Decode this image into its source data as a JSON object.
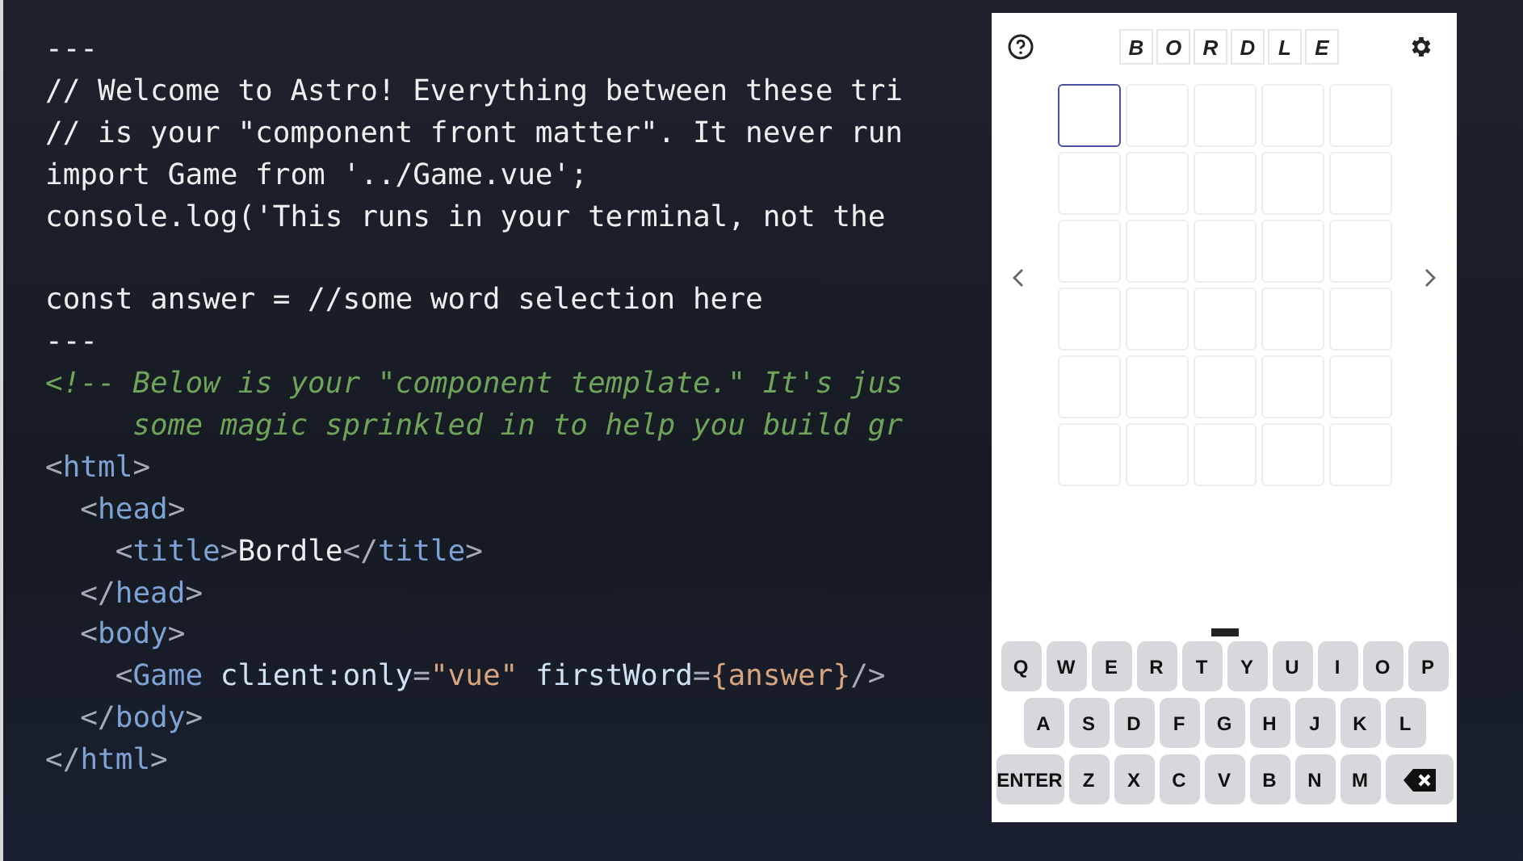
{
  "code_lines": [
    [
      {
        "kind": "plain",
        "text": "---"
      }
    ],
    [
      {
        "kind": "plain",
        "text": "// Welcome to Astro! Everything between these tri"
      }
    ],
    [
      {
        "kind": "plain",
        "text": "// is your \"component front matter\". It never run"
      }
    ],
    [
      {
        "kind": "plain",
        "text": "import Game from '../Game.vue';"
      }
    ],
    [
      {
        "kind": "plain",
        "text": "console.log('This runs in your terminal, not the"
      }
    ],
    [
      {
        "kind": "plain",
        "text": "const answer = //some word selection here",
        "gap_before": true
      }
    ],
    [
      {
        "kind": "plain",
        "text": "---"
      }
    ],
    [
      {
        "kind": "comment",
        "text": "<!-- Below is your \"component template.\" It's jus"
      }
    ],
    [
      {
        "kind": "comment",
        "text": "     some magic sprinkled in to help you build gr"
      }
    ],
    [
      {
        "kind": "punct",
        "text": "<"
      },
      {
        "kind": "tag",
        "text": "html"
      },
      {
        "kind": "punct",
        "text": ">"
      }
    ],
    [
      {
        "kind": "punct",
        "text": "  <"
      },
      {
        "kind": "tag",
        "text": "head"
      },
      {
        "kind": "punct",
        "text": ">"
      }
    ],
    [
      {
        "kind": "punct",
        "text": "    <"
      },
      {
        "kind": "tag",
        "text": "title"
      },
      {
        "kind": "punct",
        "text": ">"
      },
      {
        "kind": "plain",
        "text": "Bordle"
      },
      {
        "kind": "punct",
        "text": "</"
      },
      {
        "kind": "tag",
        "text": "title"
      },
      {
        "kind": "punct",
        "text": ">"
      }
    ],
    [
      {
        "kind": "punct",
        "text": "  </"
      },
      {
        "kind": "tag",
        "text": "head"
      },
      {
        "kind": "punct",
        "text": ">"
      }
    ],
    [
      {
        "kind": "punct",
        "text": "  <"
      },
      {
        "kind": "tag",
        "text": "body"
      },
      {
        "kind": "punct",
        "text": ">"
      }
    ],
    [
      {
        "kind": "punct",
        "text": "    <"
      },
      {
        "kind": "tag",
        "text": "Game"
      },
      {
        "kind": "attr",
        "text": "client:only",
        "space_before": true
      },
      {
        "kind": "punct",
        "text": "="
      },
      {
        "kind": "string",
        "text": "\"vue\""
      },
      {
        "kind": "attr",
        "text": "firstWord",
        "space_before": true
      },
      {
        "kind": "punct",
        "text": "="
      },
      {
        "kind": "string",
        "text": "{answer}"
      },
      {
        "kind": "punct",
        "text": "/>"
      }
    ],
    [
      {
        "kind": "punct",
        "text": "  </"
      },
      {
        "kind": "tag",
        "text": "body"
      },
      {
        "kind": "punct",
        "text": ">"
      }
    ],
    [
      {
        "kind": "punct",
        "text": "</"
      },
      {
        "kind": "tag",
        "text": "html"
      },
      {
        "kind": "punct",
        "text": ">"
      }
    ]
  ],
  "game": {
    "title_letters": [
      "B",
      "O",
      "R",
      "D",
      "L",
      "E"
    ],
    "board": [
      [
        {
          "selected": true
        },
        {
          "selected": false
        },
        {
          "selected": false
        },
        {
          "selected": false
        },
        {
          "selected": false
        }
      ],
      [
        {
          "selected": false
        },
        {
          "selected": false
        },
        {
          "selected": false
        },
        {
          "selected": false
        },
        {
          "selected": false
        }
      ],
      [
        {
          "selected": false
        },
        {
          "selected": false
        },
        {
          "selected": false
        },
        {
          "selected": false
        },
        {
          "selected": false
        }
      ],
      [
        {
          "selected": false
        },
        {
          "selected": false
        },
        {
          "selected": false
        },
        {
          "selected": false
        },
        {
          "selected": false
        }
      ],
      [
        {
          "selected": false
        },
        {
          "selected": false
        },
        {
          "selected": false
        },
        {
          "selected": false
        },
        {
          "selected": false
        }
      ],
      [
        {
          "selected": false
        },
        {
          "selected": false
        },
        {
          "selected": false
        },
        {
          "selected": false
        },
        {
          "selected": false
        }
      ]
    ],
    "keyboard": [
      [
        {
          "kind": "letter",
          "label": "Q"
        },
        {
          "kind": "letter",
          "label": "W"
        },
        {
          "kind": "letter",
          "label": "E"
        },
        {
          "kind": "letter",
          "label": "R"
        },
        {
          "kind": "letter",
          "label": "T"
        },
        {
          "kind": "letter",
          "label": "Y"
        },
        {
          "kind": "letter",
          "label": "U"
        },
        {
          "kind": "letter",
          "label": "I"
        },
        {
          "kind": "letter",
          "label": "O"
        },
        {
          "kind": "letter",
          "label": "P"
        }
      ],
      [
        {
          "kind": "letter",
          "label": "A"
        },
        {
          "kind": "letter",
          "label": "S"
        },
        {
          "kind": "letter",
          "label": "D"
        },
        {
          "kind": "letter",
          "label": "F"
        },
        {
          "kind": "letter",
          "label": "G"
        },
        {
          "kind": "letter",
          "label": "H"
        },
        {
          "kind": "letter",
          "label": "J"
        },
        {
          "kind": "letter",
          "label": "K"
        },
        {
          "kind": "letter",
          "label": "L"
        }
      ],
      [
        {
          "kind": "enter",
          "label": "ENTER"
        },
        {
          "kind": "letter",
          "label": "Z"
        },
        {
          "kind": "letter",
          "label": "X"
        },
        {
          "kind": "letter",
          "label": "C"
        },
        {
          "kind": "letter",
          "label": "V"
        },
        {
          "kind": "letter",
          "label": "B"
        },
        {
          "kind": "letter",
          "label": "N"
        },
        {
          "kind": "letter",
          "label": "M"
        },
        {
          "kind": "backspace"
        }
      ]
    ]
  }
}
